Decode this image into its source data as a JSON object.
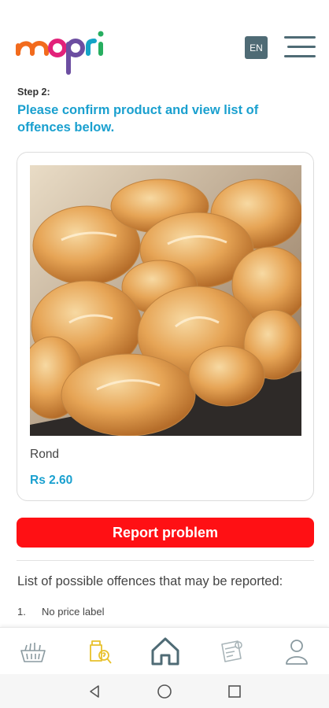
{
  "header": {
    "logo_text": "mopri",
    "language": "EN",
    "menu_icon": "hamburger-menu-icon"
  },
  "step": {
    "label": "Step 2:",
    "instruction": "Please confirm product and view list of offences below."
  },
  "product": {
    "image": "bread-rolls-photo",
    "name": "Rond",
    "price": "Rs 2.60"
  },
  "actions": {
    "report_label": "Report problem"
  },
  "offences": {
    "title": "List of possible offences that may be reported:",
    "items": [
      {
        "number": "1.",
        "text": "No price label"
      }
    ]
  },
  "tabbar": {
    "items": [
      {
        "icon": "basket-icon"
      },
      {
        "icon": "price-check-icon"
      },
      {
        "icon": "home-icon"
      },
      {
        "icon": "report-document-icon"
      },
      {
        "icon": "profile-icon"
      }
    ]
  },
  "system_nav": {
    "items": [
      "back-icon",
      "home-circle-icon",
      "recents-icon"
    ]
  },
  "colors": {
    "accent": "#1aa0cf",
    "report": "#ff1014",
    "header_icon": "#4f6b75",
    "active_tab": "#e8c12b"
  }
}
